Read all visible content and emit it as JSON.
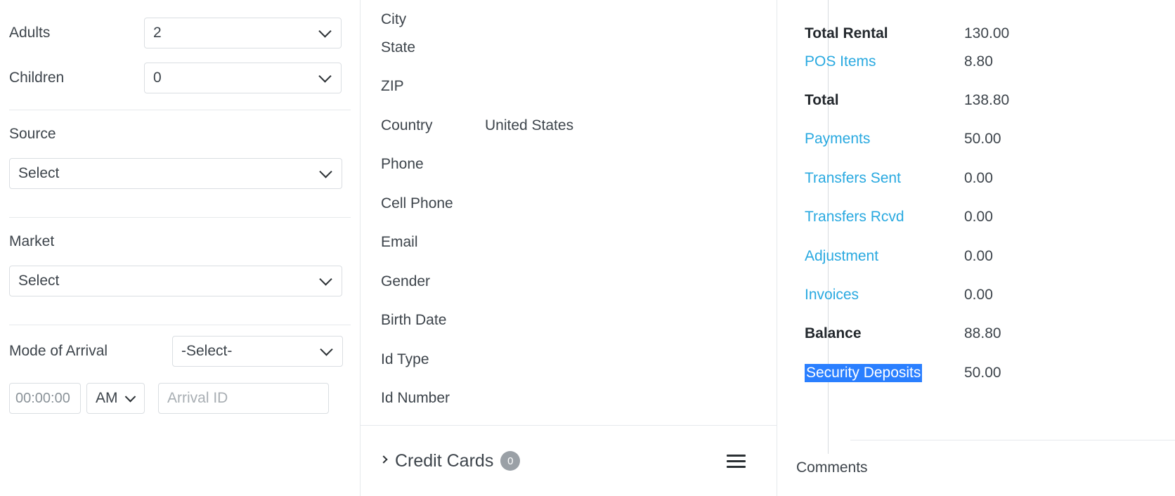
{
  "left_panel": {
    "adults": {
      "label": "Adults",
      "value": "2"
    },
    "children": {
      "label": "Children",
      "value": "0"
    },
    "source": {
      "label": "Source",
      "value": "Select"
    },
    "market": {
      "label": "Market",
      "value": "Select"
    },
    "mode_of_arrival": {
      "label": "Mode of Arrival",
      "value": "-Select-"
    },
    "arrival_time": {
      "value": "00:00:00"
    },
    "arrival_meridiem": {
      "value": "AM"
    },
    "arrival_id": {
      "placeholder": "Arrival ID",
      "value": ""
    }
  },
  "guest_panel": {
    "fields": [
      {
        "label": "City",
        "value": ""
      },
      {
        "label": "State",
        "value": ""
      },
      {
        "label": "ZIP",
        "value": ""
      },
      {
        "label": "Country",
        "value": "United States"
      },
      {
        "label": "Phone",
        "value": ""
      },
      {
        "label": "Cell Phone",
        "value": ""
      },
      {
        "label": "Email",
        "value": ""
      },
      {
        "label": "Gender",
        "value": ""
      },
      {
        "label": "Birth Date",
        "value": ""
      },
      {
        "label": "Id Type",
        "value": ""
      },
      {
        "label": "Id Number",
        "value": ""
      }
    ],
    "credit_cards": {
      "title": "Credit Cards",
      "count": "0"
    }
  },
  "folio_panel": {
    "rows": [
      {
        "label": "Total Rental",
        "value": "130.00",
        "style": "bold"
      },
      {
        "label": "POS Items",
        "value": "8.80",
        "style": "link"
      },
      {
        "label": "Total",
        "value": "138.80",
        "style": "bold"
      },
      {
        "label": "Payments",
        "value": "50.00",
        "style": "link"
      },
      {
        "label": "Transfers Sent",
        "value": "0.00",
        "style": "link"
      },
      {
        "label": "Transfers Rcvd",
        "value": "0.00",
        "style": "link"
      },
      {
        "label": "Adjustment",
        "value": "0.00",
        "style": "link"
      },
      {
        "label": "Invoices",
        "value": "0.00",
        "style": "link"
      },
      {
        "label": "Balance",
        "value": "88.80",
        "style": "bold"
      },
      {
        "label": "Security Deposits",
        "value": "50.00",
        "style": "selected"
      }
    ],
    "comments_label": "Comments"
  },
  "colors": {
    "link": "#29a9e0",
    "selection_highlight": "#2a7fff",
    "text": "#3d444b",
    "border": "#dadee2",
    "divider": "#e6e9ec",
    "badge": "#9aa0a6"
  }
}
